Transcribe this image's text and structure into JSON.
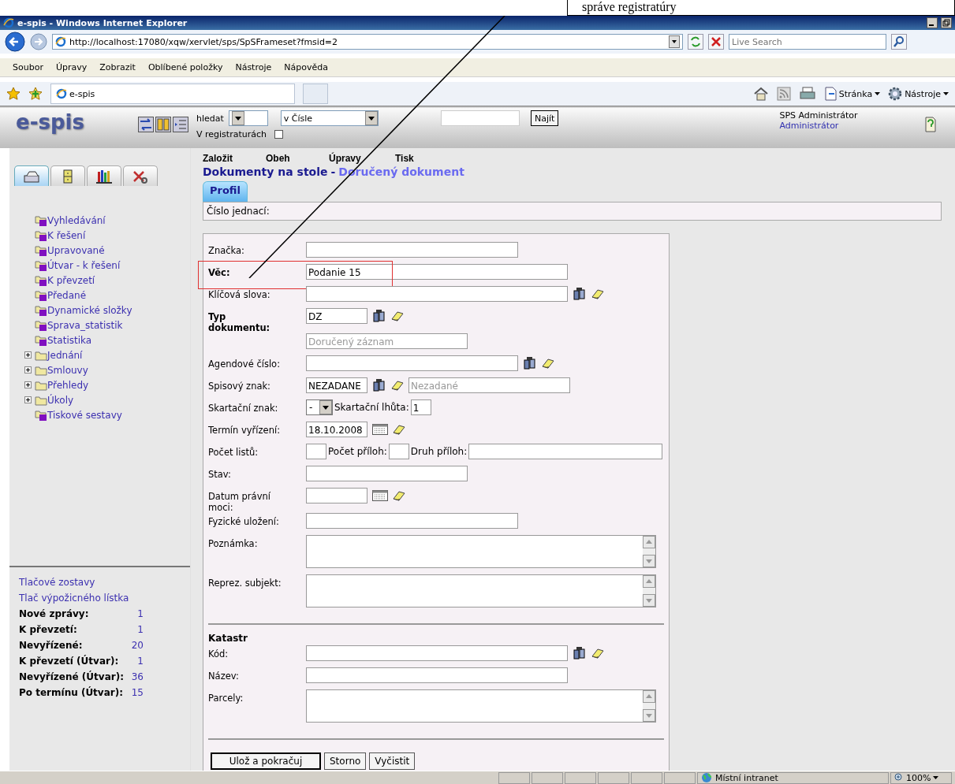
{
  "annotation": {
    "text": "správe registratúry"
  },
  "window": {
    "title": "e-spis - Windows Internet Explorer"
  },
  "address_bar": {
    "url": "http://localhost:17080/xqw/xervlet/sps/SpSFrameset?fmsid=2",
    "search_placeholder": "Live Search"
  },
  "menu": [
    "Soubor",
    "Úpravy",
    "Zobrazit",
    "Oblíbené položky",
    "Nástroje",
    "Nápověda"
  ],
  "favorites_bar": {
    "tab": "e-spis",
    "tools": [
      "Stránka",
      "Nástroje"
    ]
  },
  "app_header": {
    "logo": "e-spis",
    "search_label": "hledat",
    "search_scope": "v Čísle",
    "find_button": "Najít",
    "registry_label": "V registraturách",
    "registry_checked": false,
    "user_name": "SPS Administrátor",
    "role": "Administrátor"
  },
  "sidebar": {
    "tabs": [
      {
        "kind": "tray",
        "selected": true
      },
      {
        "kind": "cabinet",
        "selected": false
      },
      {
        "kind": "books",
        "selected": false
      },
      {
        "kind": "tools",
        "selected": false
      }
    ],
    "tree": [
      {
        "label": "Vyhledávání",
        "kind": "query"
      },
      {
        "label": "K řešení",
        "kind": "query"
      },
      {
        "label": "Upravované",
        "kind": "query"
      },
      {
        "label": "Útvar - k řešení",
        "kind": "query"
      },
      {
        "label": "K převzetí",
        "kind": "query"
      },
      {
        "label": "Předané",
        "kind": "query"
      },
      {
        "label": "Dynamické složky",
        "kind": "query"
      },
      {
        "label": "Sprava_statistik",
        "kind": "query"
      },
      {
        "label": "Statistika",
        "kind": "query"
      },
      {
        "label": "Jednání",
        "kind": "folder",
        "expanded": false
      },
      {
        "label": "Smlouvy",
        "kind": "folder",
        "expanded": false
      },
      {
        "label": "Přehledy",
        "kind": "folder",
        "expanded": false
      },
      {
        "label": "Úkoly",
        "kind": "folder",
        "expanded": false
      },
      {
        "label": "Tiskové sestavy",
        "kind": "query"
      }
    ],
    "links": [
      "Tlačové zostavy",
      "Tlač výpožicného lístka"
    ],
    "stats": [
      {
        "label": "Nové zprávy:",
        "value": "1"
      },
      {
        "label": "K převzetí:",
        "value": "1"
      },
      {
        "label": "Nevyřízené:",
        "value": "20"
      },
      {
        "label": "K převzetí (Útvar):",
        "value": "1"
      },
      {
        "label": "Nevyřízené (Útvar):",
        "value": "36"
      },
      {
        "label": "Po termínu (Útvar):",
        "value": "15"
      }
    ]
  },
  "actions": [
    "Založit",
    "Obeh",
    "Úpravy",
    "Tisk"
  ],
  "breadcrumb": {
    "parent": "Dokumenty na stole",
    "separator": "-",
    "current": "Doručený dokument"
  },
  "tabs": [
    {
      "label": "Profil",
      "selected": true
    }
  ],
  "reference_label": "Číslo jednací:",
  "form": {
    "rows": [
      {
        "label": "Značka:",
        "controls": [
          {
            "kind": "input"
          }
        ]
      },
      {
        "label": "Věc:",
        "bold": true,
        "highlighted": true,
        "controls": [
          {
            "kind": "input",
            "value": "Podanie 15"
          }
        ]
      },
      {
        "label": "Klíčová slova:",
        "controls": [
          {
            "kind": "input"
          },
          {
            "kind": "lookup"
          },
          {
            "kind": "eraser"
          }
        ]
      },
      {
        "label": "Typ dokumentu:",
        "bold": true,
        "controls": [
          {
            "kind": "input",
            "value": "DZ"
          },
          {
            "kind": "lookup"
          },
          {
            "kind": "eraser"
          }
        ]
      },
      {
        "controls": [
          {
            "kind": "input",
            "value": "Doručený záznam",
            "disabled": true
          }
        ]
      },
      {
        "label": "Agendové číslo:",
        "controls": [
          {
            "kind": "input"
          },
          {
            "kind": "lookup"
          },
          {
            "kind": "eraser"
          }
        ]
      },
      {
        "label": "Spisový znak:",
        "controls": [
          {
            "kind": "input",
            "value": "NEZADANE"
          },
          {
            "kind": "lookup"
          },
          {
            "kind": "eraser"
          },
          {
            "kind": "input",
            "value": "Nezadané",
            "disabled": true
          }
        ]
      },
      {
        "label": "Skartační znak:",
        "controls": [
          {
            "kind": "select",
            "value": "-"
          },
          {
            "kind": "label",
            "text": "Skartační lhůta:"
          },
          {
            "kind": "input",
            "value": "1"
          }
        ]
      },
      {
        "label": "Termín vyřízení:",
        "controls": [
          {
            "kind": "input",
            "value": "18.10.2008"
          },
          {
            "kind": "calendar"
          },
          {
            "kind": "eraser"
          }
        ]
      },
      {
        "label": "Počet listů:",
        "controls": [
          {
            "kind": "input"
          },
          {
            "kind": "label",
            "text": "Počet příloh:"
          },
          {
            "kind": "input"
          },
          {
            "kind": "label",
            "text": "Druh příloh:"
          },
          {
            "kind": "input"
          }
        ]
      },
      {
        "label": "Stav:",
        "controls": [
          {
            "kind": "input"
          }
        ]
      },
      {
        "label": "Datum právní moci:",
        "controls": [
          {
            "kind": "input"
          },
          {
            "kind": "calendar"
          },
          {
            "kind": "eraser"
          }
        ]
      },
      {
        "label": "Fyzické uložení:",
        "controls": [
          {
            "kind": "input"
          }
        ]
      },
      {
        "label": "Poznámka:",
        "controls": [
          {
            "kind": "textarea"
          }
        ]
      },
      {
        "label": "Reprez. subjekt:",
        "controls": [
          {
            "kind": "textarea"
          }
        ]
      }
    ],
    "section": {
      "title": "Katastr",
      "rows": [
        {
          "label": "Kód:",
          "controls": [
            {
              "kind": "input"
            },
            {
              "kind": "lookup"
            },
            {
              "kind": "eraser"
            }
          ]
        },
        {
          "label": "Název:",
          "controls": [
            {
              "kind": "input"
            }
          ]
        },
        {
          "label": "Parcely:",
          "controls": [
            {
              "kind": "textarea"
            }
          ]
        }
      ]
    },
    "buttons": [
      {
        "label": "Ulož a pokračuj",
        "default": true
      },
      {
        "label": "Storno",
        "default": false
      },
      {
        "label": "Vyčistit",
        "default": false
      }
    ]
  },
  "status_bar": {
    "zone": "Místní intranet",
    "zoom": "100%"
  }
}
